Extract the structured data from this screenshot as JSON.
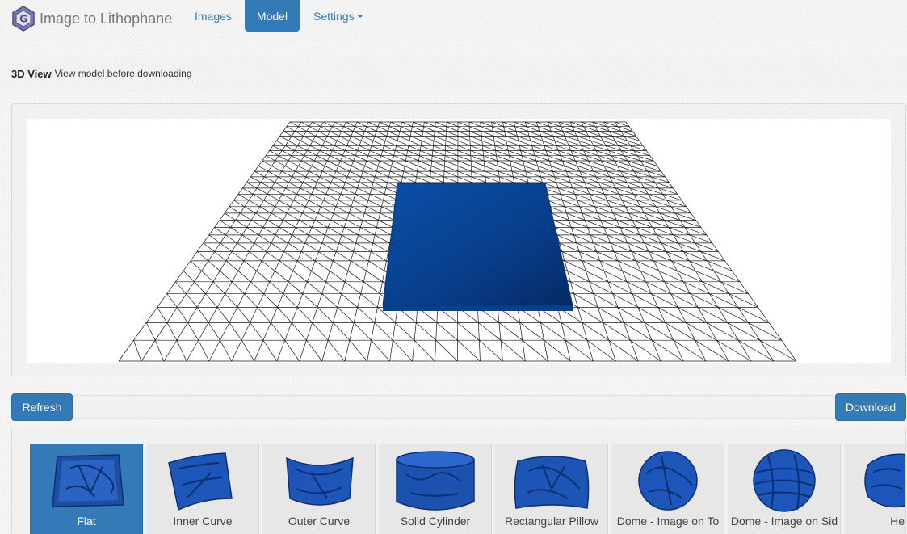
{
  "app": {
    "title": "Image to Lithophane"
  },
  "nav": {
    "images": "Images",
    "model": "Model",
    "settings": "Settings"
  },
  "panel": {
    "title": "3D View",
    "subtitle": "View model before downloading"
  },
  "toolbar": {
    "refresh": "Refresh",
    "download": "Download"
  },
  "shapes": [
    {
      "label": "Flat",
      "selected": true
    },
    {
      "label": "Inner Curve",
      "selected": false
    },
    {
      "label": "Outer Curve",
      "selected": false
    },
    {
      "label": "Solid Cylinder",
      "selected": false
    },
    {
      "label": "Rectangular Pillow",
      "selected": false
    },
    {
      "label": "Dome - Image on To",
      "selected": false
    },
    {
      "label": "Dome - Image on Sid",
      "selected": false
    },
    {
      "label": "Hea",
      "selected": false
    }
  ],
  "colors": {
    "accent": "#337ab7",
    "model": "#0a47a0",
    "grid": "#1a1a1a"
  },
  "icons": {
    "logo": "lithophane-logo-icon",
    "settings_caret": "caret-down-icon"
  }
}
